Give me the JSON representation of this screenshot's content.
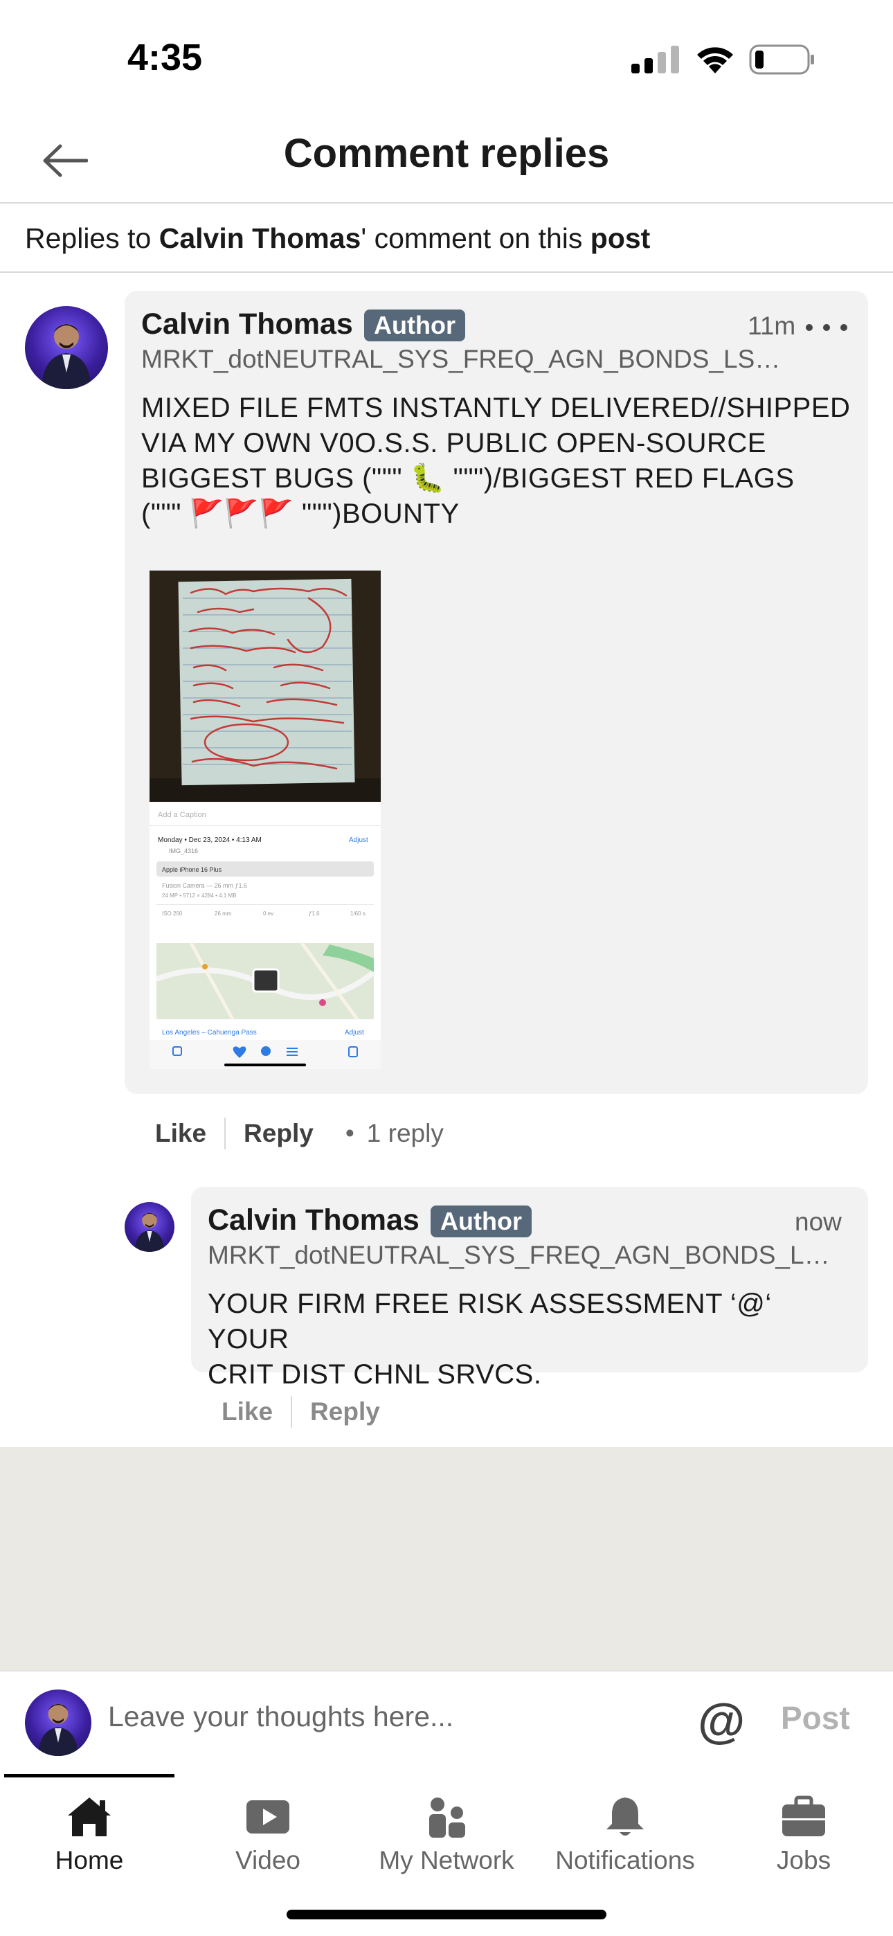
{
  "status_bar": {
    "time": "4:35"
  },
  "header": {
    "title": "Comment replies"
  },
  "subheader": {
    "prefix": "Replies to ",
    "name": "Calvin Thomas",
    "middle": "' comment on this ",
    "post_word": "post"
  },
  "comment": {
    "author": "Calvin Thomas",
    "badge": "Author",
    "time": "11m",
    "headline": "MRKT_dotNEUTRAL_SYS_FREQ_AGN_BONDS_LS_P...",
    "text_lines": [
      "MIXED FILE FMTS INSTANTLY DELIVERED//SHIPPED",
      "VIA MY OWN V0O.S.S. PUBLIC OPEN-SOURCE",
      "BIGGEST BUGS (\"\"\" 🐛 \"\"\")/BIGGEST RED FLAGS",
      "(\"\"\" 🚩🚩🚩 \"\"\")BOUNTY"
    ],
    "image_caption_placeholder": "Add a Caption",
    "image_date": "Monday • Dec 23, 2024 • 4:13 AM",
    "image_file": "IMG_4316",
    "image_adjust": "Adjust",
    "image_device": "Apple iPhone 16 Plus",
    "image_camera": "Fusion Camera — 26 mm ƒ1.6",
    "image_specs": "24 MP • 5712 × 4284 • 4.1 MB",
    "image_exif": [
      "ISO 200",
      "26 mm",
      "0 ev",
      "ƒ1.6",
      "1/60 s"
    ],
    "image_location": "Los Angeles – Cahuenga Pass",
    "like_label": "Like",
    "reply_label": "Reply",
    "reply_count": "1 reply"
  },
  "reply": {
    "author": "Calvin Thomas",
    "badge": "Author",
    "time": "now",
    "headline": "MRKT_dotNEUTRAL_SYS_FREQ_AGN_BONDS_LS_...",
    "text_lines": [
      "YOUR FIRM FREE RISK ASSESSMENT ‘@‘ YOUR",
      "CRIT DIST CHNL SRVCS."
    ],
    "like_label": "Like",
    "reply_label": "Reply"
  },
  "composer": {
    "placeholder": "Leave your thoughts here...",
    "at_symbol": "@",
    "post_label": "Post"
  },
  "nav": {
    "items": [
      {
        "label": "Home",
        "icon": "home-icon",
        "active": true
      },
      {
        "label": "Video",
        "icon": "video-icon",
        "active": false
      },
      {
        "label": "My Network",
        "icon": "network-icon",
        "active": false
      },
      {
        "label": "Notifications",
        "icon": "bell-icon",
        "active": false
      },
      {
        "label": "Jobs",
        "icon": "briefcase-icon",
        "active": false
      }
    ]
  },
  "colors": {
    "badge_bg": "#56687a",
    "bubble_bg": "#f2f2f2",
    "feed_bg": "#ebe9e4"
  }
}
